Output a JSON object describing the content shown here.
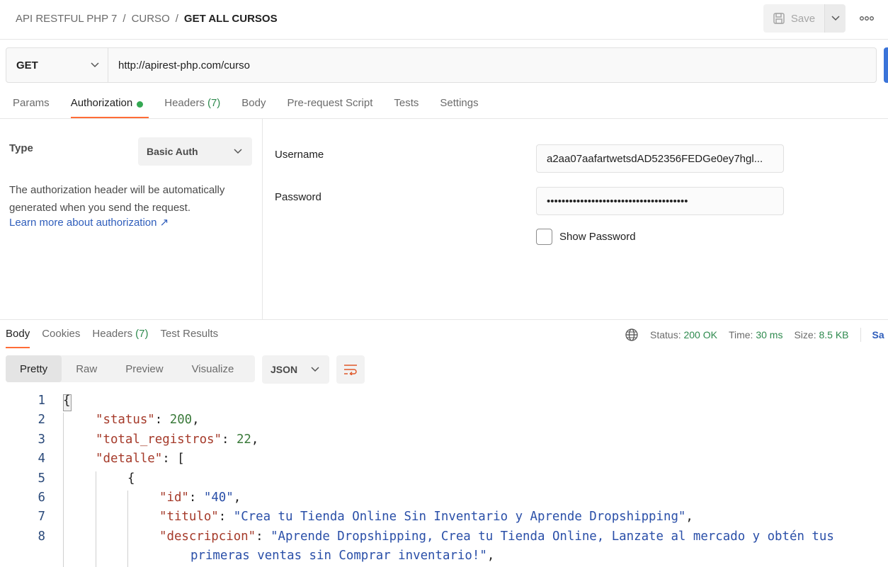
{
  "breadcrumb": [
    "API RESTFUL PHP 7",
    "CURSO",
    "GET ALL CURSOS"
  ],
  "header": {
    "save_label": "Save"
  },
  "request": {
    "method": "GET",
    "url": "http://apirest-php.com/curso"
  },
  "request_tabs": [
    {
      "label": "Params"
    },
    {
      "label": "Authorization"
    },
    {
      "label": "Headers",
      "count": "(7)"
    },
    {
      "label": "Body"
    },
    {
      "label": "Pre-request Script"
    },
    {
      "label": "Tests"
    },
    {
      "label": "Settings"
    }
  ],
  "auth": {
    "type_label": "Type",
    "type_value": "Basic Auth",
    "description": "The authorization header will be automatically generated when you send the request.",
    "learn_more": "Learn more about authorization ↗",
    "username_label": "Username",
    "username_value": "a2aa07aafartwetsdAD52356FEDGe0ey7hgl...",
    "password_label": "Password",
    "password_value": "••••••••••••••••••••••••••••••••••••••",
    "show_password_label": "Show Password"
  },
  "response_tabs": [
    {
      "label": "Body"
    },
    {
      "label": "Cookies"
    },
    {
      "label": "Headers",
      "count": "(7)"
    },
    {
      "label": "Test Results"
    }
  ],
  "status": {
    "status_label": "Status:",
    "status_value": "200 OK",
    "time_label": "Time:",
    "time_value": "30 ms",
    "size_label": "Size:",
    "size_value": "8.5 KB",
    "save_label": "Sa"
  },
  "views": [
    "Pretty",
    "Raw",
    "Preview",
    "Visualize"
  ],
  "format": "JSON",
  "code_lines": [
    {
      "num": "1",
      "parts": [
        {
          "c": "p",
          "t": "{"
        }
      ]
    },
    {
      "num": "2",
      "parts": [
        {
          "c": "k",
          "t": "\"status\""
        },
        {
          "c": "p",
          "t": ": "
        },
        {
          "c": "n",
          "t": "200"
        },
        {
          "c": "p",
          "t": ","
        }
      ]
    },
    {
      "num": "3",
      "parts": [
        {
          "c": "k",
          "t": "\"total_registros\""
        },
        {
          "c": "p",
          "t": ": "
        },
        {
          "c": "n",
          "t": "22"
        },
        {
          "c": "p",
          "t": ","
        }
      ]
    },
    {
      "num": "4",
      "parts": [
        {
          "c": "k",
          "t": "\"detalle\""
        },
        {
          "c": "p",
          "t": ": ["
        }
      ]
    },
    {
      "num": "5",
      "parts": [
        {
          "c": "p",
          "t": "{"
        }
      ]
    },
    {
      "num": "6",
      "parts": [
        {
          "c": "k",
          "t": "\"id\""
        },
        {
          "c": "p",
          "t": ": "
        },
        {
          "c": "s",
          "t": "\"40\""
        },
        {
          "c": "p",
          "t": ","
        }
      ]
    },
    {
      "num": "7",
      "parts": [
        {
          "c": "k",
          "t": "\"titulo\""
        },
        {
          "c": "p",
          "t": ": "
        },
        {
          "c": "s",
          "t": "\"Crea tu Tienda Online Sin Inventario y Aprende Dropshipping\""
        },
        {
          "c": "p",
          "t": ","
        }
      ]
    },
    {
      "num": "8",
      "parts": [
        {
          "c": "k",
          "t": "\"descripcion\""
        },
        {
          "c": "p",
          "t": ": "
        },
        {
          "c": "s",
          "t": "\"Aprende Dropshipping, Crea tu Tienda Online, Lanzate al mercado y obtén tus"
        }
      ]
    },
    {
      "num": "",
      "parts": [
        {
          "c": "s",
          "t": "primeras ventas sin Comprar inventario!\""
        },
        {
          "c": "p",
          "t": ","
        }
      ]
    }
  ]
}
